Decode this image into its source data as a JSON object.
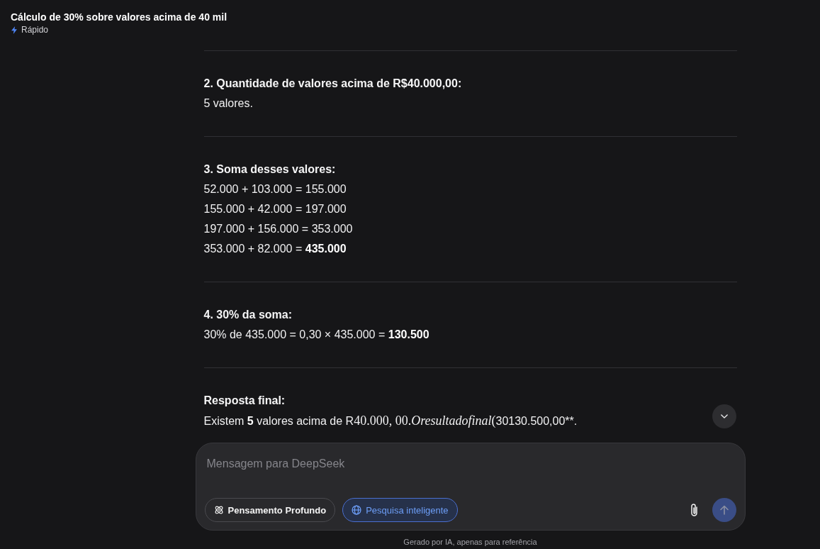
{
  "header": {
    "title": "Cálculo de 30% sobre valores acima de 40 mil",
    "mode": {
      "label": "Rápido"
    }
  },
  "message": {
    "sections": [
      {
        "heading": "2. Quantidade de valores acima de R$40.000,00:",
        "lines": [
          {
            "text": "5 valores."
          }
        ]
      },
      {
        "heading": "3. Soma desses valores:",
        "lines": [
          {
            "text": "52.000 + 103.000 = 155.000"
          },
          {
            "text": "155.000 + 42.000 = 197.000"
          },
          {
            "text": "197.000 + 156.000 = 353.000"
          },
          {
            "text": "353.000 + 82.000 = **435.000**"
          }
        ]
      },
      {
        "heading": "4. 30% da soma:",
        "lines": [
          {
            "text": "30% de 435.000 = 0,30 × 435.000 = **130.500**"
          }
        ]
      },
      {
        "heading": "Resposta final:",
        "lines": [
          {
            "segments": [
              {
                "kind": "text",
                "text": "Existem "
              },
              {
                "kind": "bold",
                "text": "5"
              },
              {
                "kind": "text",
                "text": " valores acima de R"
              },
              {
                "kind": "math",
                "text": "40.000, 00."
              },
              {
                "kind": "math-italic",
                "text": "Oresultadofinal"
              },
              {
                "kind": "math",
                "text": "("
              },
              {
                "kind": "text",
                "text": "30130.500,00**."
              }
            ]
          }
        ]
      }
    ]
  },
  "composer": {
    "placeholder": "Mensagem para DeepSeek",
    "toggles": [
      {
        "label": "Pensamento Profundo",
        "selected": false
      },
      {
        "label": "Pesquisa inteligente",
        "selected": true
      }
    ],
    "send_button": {
      "disabled": true
    }
  },
  "footer": {
    "disclaimer": "Gerado por IA, apenas para referência"
  }
}
